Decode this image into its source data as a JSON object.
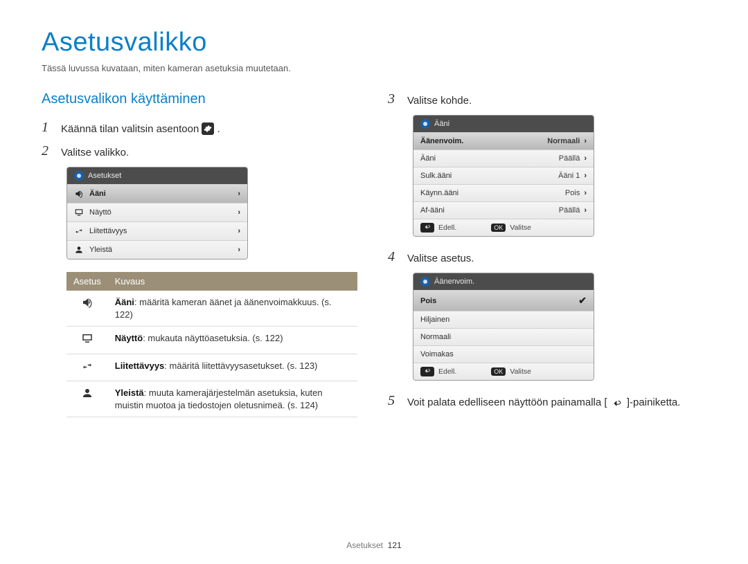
{
  "title": "Asetusvalikko",
  "intro": "Tässä luvussa kuvataan, miten kameran asetuksia muutetaan.",
  "section_heading": "Asetusvalikon käyttäminen",
  "steps": {
    "s1": {
      "num": "1",
      "text_before": "Käännä tilan valitsin asentoon ",
      "text_after": "."
    },
    "s2": {
      "num": "2",
      "text": "Valitse valikko."
    },
    "s3": {
      "num": "3",
      "text": "Valitse kohde."
    },
    "s4": {
      "num": "4",
      "text": "Valitse asetus."
    },
    "s5": {
      "num": "5",
      "text_before": "Voit palata edelliseen näyttöön painamalla [",
      "text_after": "]-painiketta."
    }
  },
  "menu1": {
    "header": "Asetukset",
    "items": [
      {
        "icon": "speaker",
        "label": "Ääni",
        "selected": true
      },
      {
        "icon": "monitor",
        "label": "Näyttö",
        "selected": false
      },
      {
        "icon": "link",
        "label": "Liitettävyys",
        "selected": false
      },
      {
        "icon": "person",
        "label": "Yleistä",
        "selected": false
      }
    ]
  },
  "menu2": {
    "header": "Ääni",
    "rows": [
      {
        "label": "Äänenvoim.",
        "value": "Normaali",
        "selected": true
      },
      {
        "label": "Ääni",
        "value": "Päällä"
      },
      {
        "label": "Sulk.ääni",
        "value": "Ääni 1"
      },
      {
        "label": "Käynn.ääni",
        "value": "Pois"
      },
      {
        "label": "Af-ääni",
        "value": "Päällä"
      }
    ],
    "footer_back": "Edell.",
    "footer_ok": "Valitse"
  },
  "menu3": {
    "header": "Äänenvoim.",
    "rows": [
      {
        "label": "Pois",
        "selected": true,
        "checked": true
      },
      {
        "label": "Hiljainen"
      },
      {
        "label": "Normaali"
      },
      {
        "label": "Voimakas"
      }
    ],
    "footer_back": "Edell.",
    "footer_ok": "Valitse"
  },
  "table": {
    "head_setting": "Asetus",
    "head_desc": "Kuvaus",
    "rows": [
      {
        "icon": "speaker",
        "bold": "Ääni",
        "rest": ": määritä kameran äänet ja äänenvoimakkuus. (s. 122)"
      },
      {
        "icon": "monitor",
        "bold": "Näyttö",
        "rest": ": mukauta näyttöasetuksia. (s. 122)"
      },
      {
        "icon": "link",
        "bold": "Liitettävyys",
        "rest": ": määritä liitettävyysasetukset. (s. 123)"
      },
      {
        "icon": "person",
        "bold": "Yleistä",
        "rest": ": muuta kamerajärjestelmän asetuksia, kuten muistin muotoa ja tiedostojen oletusnimeä. (s. 124)"
      }
    ]
  },
  "footer": {
    "label": "Asetukset",
    "page": "121"
  },
  "okLabel": "OK"
}
